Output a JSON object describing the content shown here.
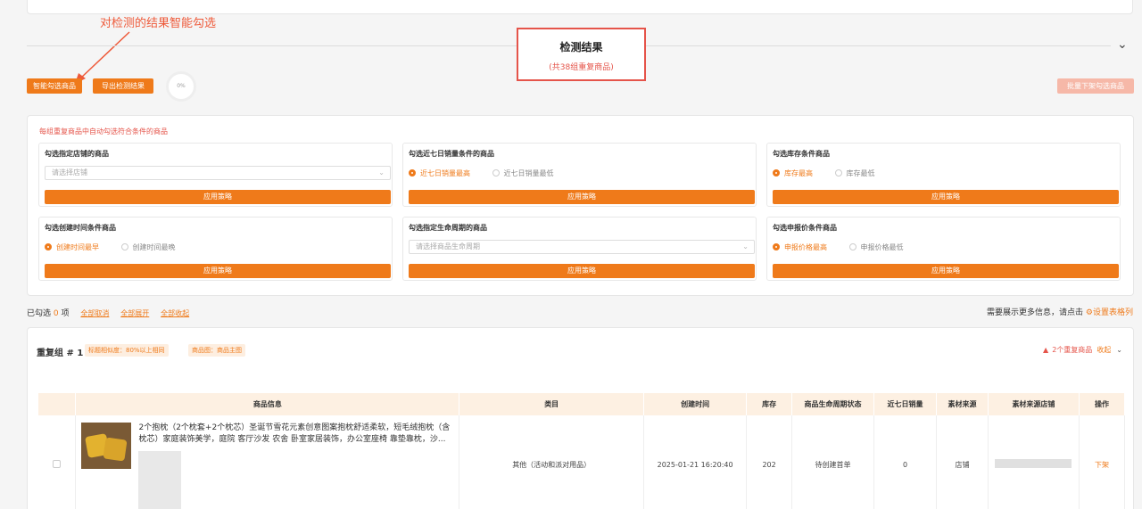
{
  "annotation": {
    "text": "对检测的结果智能勾选"
  },
  "result": {
    "title": "检测结果",
    "subtitle": "(共38组重复商品)"
  },
  "toolbar": {
    "smart_select": "智能勾选商品",
    "export": "导出检测结果",
    "progress": "0%",
    "bulk_delist": "批量下架勾选商品"
  },
  "strategy": {
    "hint": "每组重复商品中自动勾选符合条件的商品",
    "apply_label": "应用策略",
    "cells": [
      {
        "title": "勾选指定店铺的商品",
        "placeholder": "请选择店铺"
      },
      {
        "title": "勾选近七日销量条件的商品",
        "options": [
          "近七日销量最高",
          "近七日销量最低"
        ]
      },
      {
        "title": "勾选库存条件商品",
        "options": [
          "库存最高",
          "库存最低"
        ]
      },
      {
        "title": "勾选创建时间条件商品",
        "options": [
          "创建时间最早",
          "创建时间最晚"
        ]
      },
      {
        "title": "勾选指定生命周期的商品",
        "placeholder": "请选择商品生命周期"
      },
      {
        "title": "勾选申报价条件商品",
        "options": [
          "申报价格最高",
          "申报价格最低"
        ]
      }
    ]
  },
  "selection": {
    "prefix": "已勾选",
    "count": "0",
    "suffix": "项",
    "cancel_all": "全部取消",
    "expand_all": "全部展开",
    "collapse_all": "全部收起"
  },
  "more_info": {
    "text": "需要展示更多信息，请点击",
    "link": "设置表格列"
  },
  "group": {
    "title": "重复组 # 1",
    "tag1": "标题相似度：80%以上相同",
    "tag2": "商品图：商品主图",
    "count_text": "2个重复商品",
    "fold": "收起"
  },
  "table": {
    "headers": [
      "商品信息",
      "类目",
      "创建时间",
      "库存",
      "商品生命周期状态",
      "近七日销量",
      "素材来源",
      "素材来源店铺",
      "操作"
    ],
    "row": {
      "title": "2个抱枕（2个枕套+2个枕芯）圣诞节雪花元素创意图案抱枕舒适柔软，短毛绒抱枕（含枕芯）家庭装饰美学，庭院 客厅沙发 农舍 卧室家居装饰，办公室座椅 靠垫靠枕，沙...",
      "category": "其他（活动和派对用品）",
      "created": "2025-01-21 16:20:40",
      "stock": "202",
      "lifecycle": "待创建首单",
      "sales7": "0",
      "source": "店铺",
      "action": "下架"
    }
  },
  "colors": {
    "accent": "#ef7a1a",
    "danger": "#e5544a"
  }
}
